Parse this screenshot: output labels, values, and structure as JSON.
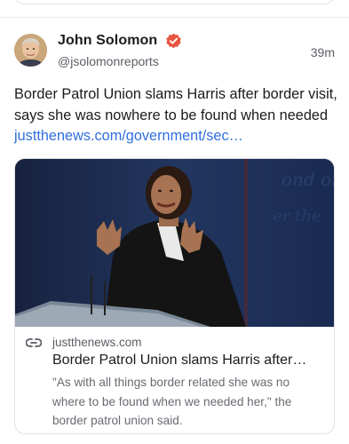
{
  "post": {
    "author_name": "John Solomon",
    "handle": "@jsolomonreports",
    "timestamp": "39m",
    "text": "Border Patrol Union slams Harris after border visit, says she was nowhere to be found when needed ",
    "link_text": "justthenews.com/government/sec…",
    "verified_icon": "verified-badge-icon",
    "verified_color": "#e8553e",
    "link_color": "#2f6fde"
  },
  "link_card": {
    "domain": "justthenews.com",
    "title": "Border Patrol Union slams Harris after…",
    "description": "\"As with all things border related she was no where to be found when we needed her,\" the border patrol union said.",
    "image": "photo of speaker at podium gesturing with both hands, dark blue background",
    "link_icon": "link-chain-icon"
  }
}
